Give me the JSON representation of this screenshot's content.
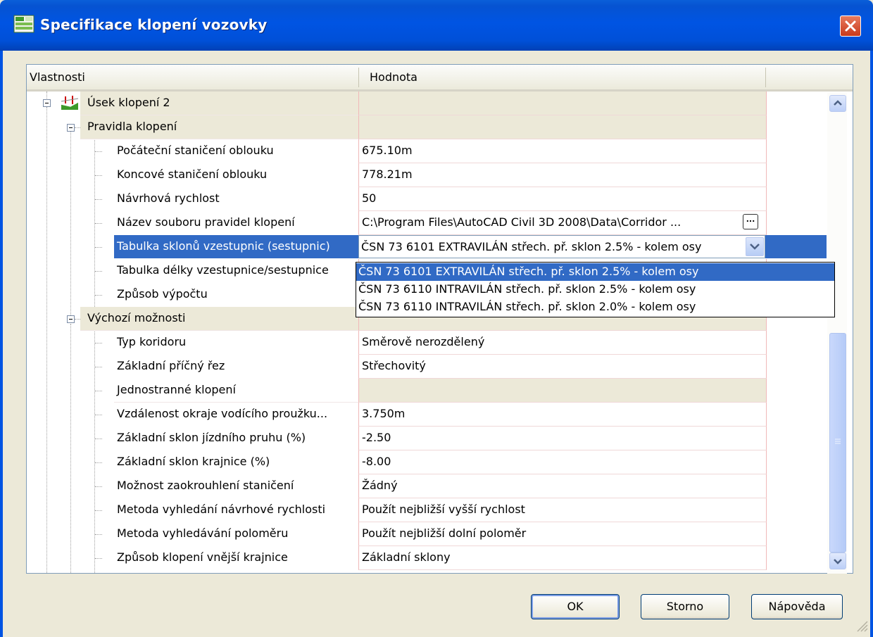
{
  "window": {
    "title": "Specifikace klopení vozovky"
  },
  "grid": {
    "headers": {
      "properties": "Vlastnosti",
      "value": "Hodnota"
    },
    "rows": [
      {
        "label": "Úsek klopení 2",
        "value": ""
      },
      {
        "label": "Pravidla klopení",
        "value": ""
      },
      {
        "label": "Počáteční staničení oblouku",
        "value": "675.10m"
      },
      {
        "label": "Koncové staničení oblouku",
        "value": "778.21m"
      },
      {
        "label": "Návrhová rychlost",
        "value": "50"
      },
      {
        "label": "Název souboru pravidel klopení",
        "value": "C:\\Program Files\\AutoCAD Civil 3D 2008\\Data\\Corridor ...",
        "button": "..."
      },
      {
        "label": "Tabulka sklonů vzestupnic (sestupnic)",
        "value": "ČSN 73 6101 EXTRAVILÁN střech. př. sklon 2.5% - kolem osy"
      },
      {
        "label": "Tabulka délky vzestupnice/sestupnice",
        "value": ""
      },
      {
        "label": "Způsob výpočtu",
        "value": ""
      },
      {
        "label": "Výchozí možnosti",
        "value": ""
      },
      {
        "label": "Typ koridoru",
        "value": "Směrově nerozdělený"
      },
      {
        "label": "Základní příčný řez",
        "value": "Střechovitý"
      },
      {
        "label": "Jednostranné klopení",
        "value": ""
      },
      {
        "label": "Vzdálenost okraje vodícího proužku...",
        "value": "3.750m"
      },
      {
        "label": "Základní sklon jízdního pruhu (%)",
        "value": "-2.50"
      },
      {
        "label": "Základní sklon krajnice (%)",
        "value": "-8.00"
      },
      {
        "label": "Možnost zaokrouhlení staničení",
        "value": "Žádný"
      },
      {
        "label": "Metoda vyhledání návrhové rychlosti",
        "value": "Použít nejbližší vyšší rychlost"
      },
      {
        "label": "Metoda vyhledávání poloměru",
        "value": "Použít nejbližší dolní poloměr"
      },
      {
        "label": "Způsob klopení vnější krajnice",
        "value": "Základní sklony"
      }
    ]
  },
  "dropdown": {
    "options": [
      "ČSN 73 6101 EXTRAVILÁN střech. př. sklon 2.5% - kolem osy",
      "ČSN 73 6110 INTRAVILÁN střech. př. sklon 2.5% - kolem osy",
      "ČSN 73 6110 INTRAVILÁN střech. př. sklon 2.0% - kolem osy"
    ],
    "selected_index": 0
  },
  "buttons": {
    "ok": "OK",
    "cancel": "Storno",
    "help": "Nápověda"
  },
  "colors": {
    "titlebar": "#0054e3",
    "selection": "#316ac5",
    "dialog": "#ece9d8"
  }
}
